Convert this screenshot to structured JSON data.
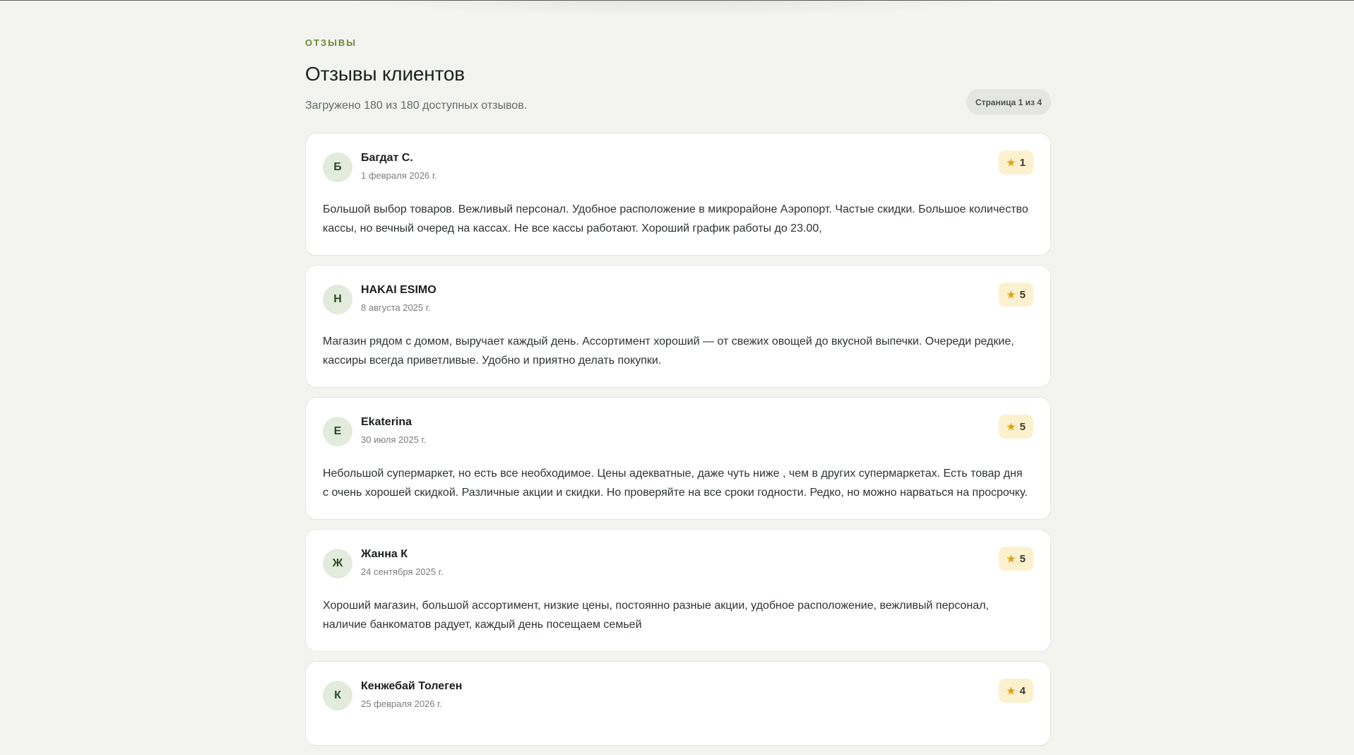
{
  "header": {
    "eyebrow": "ОТЗЫВЫ",
    "title": "Отзывы клиентов",
    "subtitle": "Загружено 180 из 180 доступных отзывов.",
    "page_indicator": "Страница 1 из 4"
  },
  "colors": {
    "background": "#f3f4f0",
    "accent": "#6b8a2f",
    "card": "#ffffff",
    "avatar_bg": "#e2ebdc",
    "rating_bg": "#fcf1cf",
    "star": "#e0a21b"
  },
  "reviews": [
    {
      "initial": "Б",
      "author": "Багдат С.",
      "date": "1 февраля 2026 г.",
      "star_icon": "★",
      "rating": "1",
      "text": "Большой выбор товаров. Вежливый персонал. Удобное расположение в микрорайоне Аэропорт. Частые скидки. Большое количество кассы, но вечный очеред на кассах. Не все кассы работают. Хороший график работы до 23.00,"
    },
    {
      "initial": "H",
      "author": "HAKAI ESIMO",
      "date": "8 августа 2025 г.",
      "star_icon": "★",
      "rating": "5",
      "text": "Магазин рядом с домом, выручает каждый день. Ассортимент хороший — от свежих овощей до вкусной выпечки. Очереди редкие, кассиры всегда приветливые. Удобно и приятно делать покупки."
    },
    {
      "initial": "E",
      "author": "Ekaterina",
      "date": "30 июля 2025 г.",
      "star_icon": "★",
      "rating": "5",
      "text": "Небольшой супермаркет, но есть все необходимое. Цены адекватные, даже чуть ниже , чем в других супермаркетах. Есть товар дня с очень хорошей скидкой. Различные акции и скидки. Но проверяйте на все сроки годности. Редко, но можно нарваться на просрочку."
    },
    {
      "initial": "Ж",
      "author": "Жанна К",
      "date": "24 сентября 2025 г.",
      "star_icon": "★",
      "rating": "5",
      "text": "Хороший магазин, большой ассортимент, низкие цены, постоянно разные акции, удобное расположение, вежливый персонал, наличие банкоматов радует, каждый день посещаем семьей"
    },
    {
      "initial": "К",
      "author": "Кенжебай Толеген",
      "date": "25 февраля 2026 г.",
      "star_icon": "★",
      "rating": "4",
      "text": ""
    }
  ]
}
